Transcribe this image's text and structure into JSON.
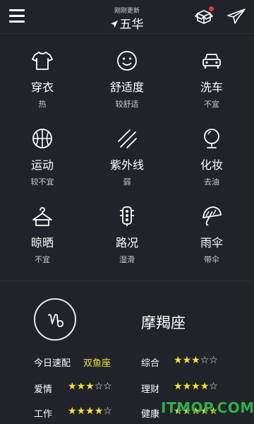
{
  "header": {
    "updated_text": "刚刚更新",
    "city": "五华",
    "icons": {
      "menu": "menu-icon",
      "location": "location-arrow-icon",
      "box": "box-icon",
      "send": "send-icon"
    }
  },
  "indices": [
    {
      "label": "穿衣",
      "value": "热",
      "icon": "tshirt-icon"
    },
    {
      "label": "舒适度",
      "value": "较舒适",
      "icon": "smiley-icon"
    },
    {
      "label": "洗车",
      "value": "不宜",
      "icon": "car-icon"
    },
    {
      "label": "运动",
      "value": "较不宜",
      "icon": "basketball-icon"
    },
    {
      "label": "紫外线",
      "value": "弱",
      "icon": "uv-rays-icon"
    },
    {
      "label": "化妆",
      "value": "去油",
      "icon": "mirror-icon"
    },
    {
      "label": "晾晒",
      "value": "不宜",
      "icon": "hanger-icon"
    },
    {
      "label": "路况",
      "value": "湿滑",
      "icon": "traffic-light-icon"
    },
    {
      "label": "雨伞",
      "value": "带伞",
      "icon": "umbrella-icon"
    }
  ],
  "horoscope": {
    "symbol": "♑",
    "name": "摩羯座",
    "match_label": "今日速配",
    "match_value": "双鱼座",
    "fortunes": [
      {
        "label": "综合",
        "rating": 3,
        "max": 5
      },
      {
        "label": "爱情",
        "rating": 3,
        "max": 5
      },
      {
        "label": "理财",
        "rating": 4,
        "max": 5
      },
      {
        "label": "工作",
        "rating": 4,
        "max": 5
      },
      {
        "label": "健康",
        "rating": 5,
        "max": 5
      }
    ]
  },
  "watermark": "ITMOP.COM",
  "colors": {
    "background": "#202329",
    "star_on": "#f2e43a",
    "match": "#f2e43a",
    "watermark": "#2fae49"
  }
}
